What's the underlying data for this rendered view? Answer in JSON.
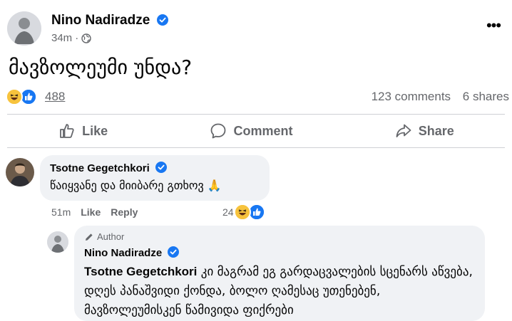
{
  "post": {
    "author": "Nino Nadiradze",
    "time": "34m",
    "more_label": "•••",
    "text": "მავზოლეუმი უნდა?",
    "reactions": {
      "count": "488",
      "types": [
        "haha",
        "like"
      ]
    },
    "comments_count": "123 comments",
    "shares_count": "6 shares"
  },
  "actions": {
    "like": "Like",
    "comment": "Comment",
    "share": "Share"
  },
  "comment": {
    "author": "Tsotne Gegetchkori",
    "text": "წაიყვანე და მიიბარე გთხოვ 🙏",
    "time": "51m",
    "like": "Like",
    "reply": "Reply",
    "reaction_count": "24",
    "reaction_types": [
      "haha",
      "like"
    ]
  },
  "reply": {
    "badge": "Author",
    "author": "Nino Nadiradze",
    "mention": "Tsotne Gegetchkori",
    "text": " კი მაგრამ ეგ გარდაცვალების სცენარს აწვება, დღეს პანაშვიდი ქონდა, ბოლო ღამესაც უთენებენ, მავზოლეუმისკენ წამივიდა ფიქრები"
  },
  "colors": {
    "brand_blue": "#1877f2",
    "muted_text": "#65676b",
    "bubble_bg": "#f0f2f5",
    "haha_yellow": "#f7c33d"
  }
}
